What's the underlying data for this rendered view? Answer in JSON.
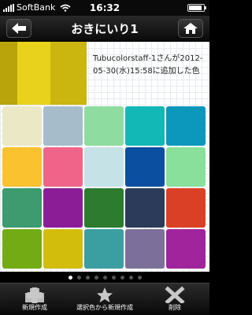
{
  "status": {
    "carrier": "SoftBank",
    "time": "16:32",
    "battery_level": 0.9
  },
  "nav": {
    "title": "おきにいり1",
    "back_icon": "left-arrow-icon",
    "home_icon": "home-icon"
  },
  "detail": {
    "description": "Tubucolorstaff-1さんが2012-05-30(水)15:58に追加した色",
    "thumb_color": "#d6bf10"
  },
  "swatches": [
    "#ebe8c6",
    "#a6bccb",
    "#8fdca0",
    "#12b8b5",
    "#0c97bd",
    "#f9c22e",
    "#f06489",
    "#c5e2e6",
    "#0a4fa0",
    "#89e09a",
    "#3d9b6f",
    "#8b1e97",
    "#2d7b2f",
    "#2c3b59",
    "#da4025",
    "#72ab13",
    "#d3bd0c",
    "#3b9ea0",
    "#7c709a",
    "#a0249c"
  ],
  "pager": {
    "count": 9,
    "active": 0
  },
  "toolbar": {
    "items": [
      {
        "label": "新規作成",
        "icon": "plus-icon"
      },
      {
        "label": "選択色から新規作成",
        "icon": "star-icon"
      },
      {
        "label": "削除",
        "icon": "delete-x-icon"
      }
    ]
  }
}
